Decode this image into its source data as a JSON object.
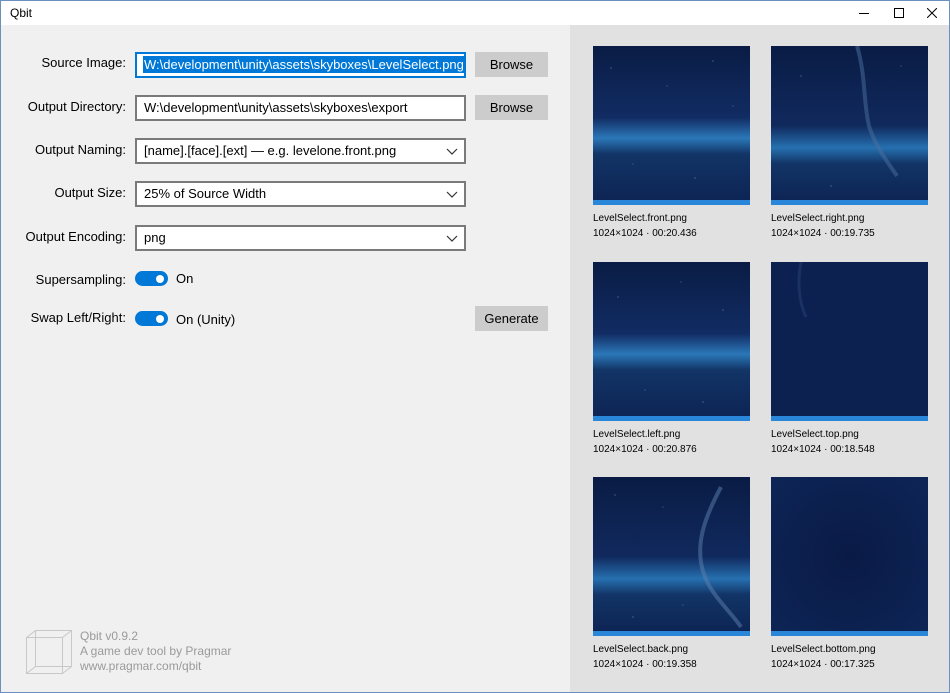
{
  "window": {
    "title": "Qbit"
  },
  "form": {
    "source_image": {
      "label": "Source Image:",
      "value": "W:\\development\\unity\\assets\\skyboxes\\LevelSelect.png",
      "button": "Browse"
    },
    "output_directory": {
      "label": "Output Directory:",
      "value": "W:\\development\\unity\\assets\\skyboxes\\export",
      "button": "Browse"
    },
    "output_naming": {
      "label": "Output Naming:",
      "value": "[name].[face].[ext] — e.g. levelone.front.png"
    },
    "output_size": {
      "label": "Output Size:",
      "value": "25% of Source Width"
    },
    "output_encoding": {
      "label": "Output Encoding:",
      "value": "png"
    },
    "supersampling": {
      "label": "Supersampling:",
      "state": "On",
      "on": true
    },
    "swap_left_right": {
      "label": "Swap Left/Right:",
      "state": "On (Unity)",
      "on": true
    },
    "generate_button": "Generate"
  },
  "about": {
    "version": "Qbit v0.9.2",
    "tagline": "A game dev tool by Pragmar",
    "url": "www.pragmar.com/qbit"
  },
  "previews": [
    {
      "name": "LevelSelect.front.png",
      "meta": "1024×1024 · 00:20.436"
    },
    {
      "name": "LevelSelect.right.png",
      "meta": "1024×1024 · 00:19.735"
    },
    {
      "name": "LevelSelect.left.png",
      "meta": "1024×1024 · 00:20.876"
    },
    {
      "name": "LevelSelect.top.png",
      "meta": "1024×1024 · 00:18.548"
    },
    {
      "name": "LevelSelect.back.png",
      "meta": "1024×1024 · 00:19.358"
    },
    {
      "name": "LevelSelect.bottom.png",
      "meta": "1024×1024 · 00:17.325"
    }
  ],
  "colors": {
    "accent": "#0078d7",
    "panel_left": "#f0f0f0",
    "panel_right": "#e1e1e1",
    "sky_dark": "#0b1f4a",
    "horizon_glow": "#2f7fc4"
  }
}
